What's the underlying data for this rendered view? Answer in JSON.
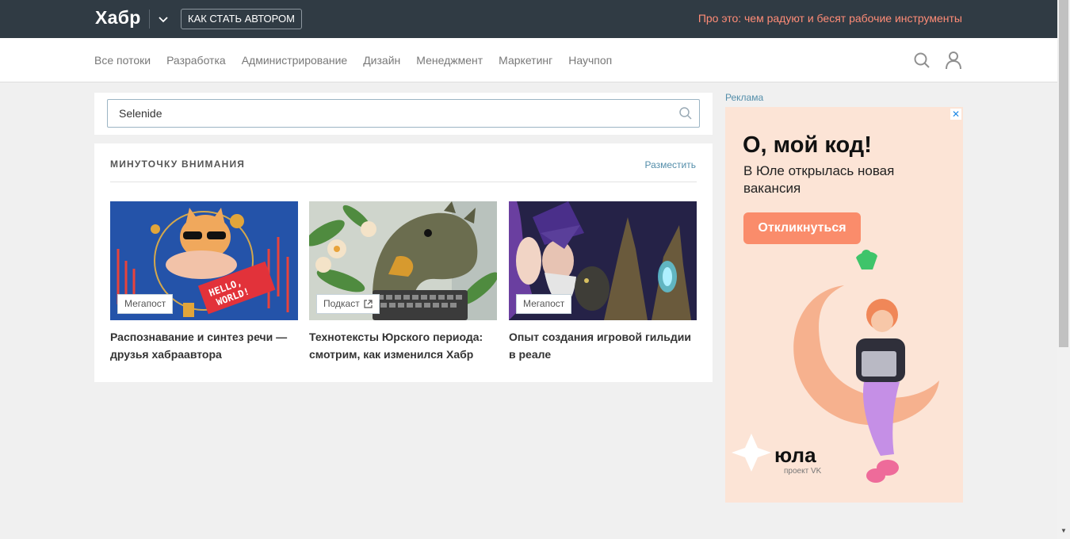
{
  "header": {
    "logo": "Хабр",
    "author_button": "КАК СТАТЬ АВТОРОМ",
    "promo_link": "Про это: чем радуют и бесят рабочие инструменты",
    "colors": {
      "bar": "#303b44",
      "promo": "#ff8c77"
    }
  },
  "nav": {
    "items": [
      "Все потоки",
      "Разработка",
      "Администрирование",
      "Дизайн",
      "Менеджмент",
      "Маркетинг",
      "Научпоп"
    ]
  },
  "search": {
    "value": "Selenide"
  },
  "attention": {
    "title": "МИНУТОЧКУ ВНИМАНИЯ",
    "place_link": "Разместить",
    "tiles": [
      {
        "badge": "Мегапост",
        "title": "Распознавание и синтез речи — друзья хабраавтора",
        "external": false
      },
      {
        "badge": "Подкаст",
        "title": "Технотексты Юрского периода: смотрим, как изменился Хабр",
        "external": true
      },
      {
        "badge": "Мегапост",
        "title": "Опыт создания игровой гильдии в реале",
        "external": false
      }
    ]
  },
  "ad": {
    "label": "Реклама",
    "close": "✕",
    "headline": "О, мой код!",
    "subline": "В Юле открылась новая вакансия",
    "cta": "Откликнуться",
    "brand": "юла",
    "brand_sub": "проект VK",
    "colors": {
      "bg": "#fce4d6",
      "cta": "#fa8c6b"
    }
  },
  "scrollbar": {
    "down_arrow": "▼"
  }
}
